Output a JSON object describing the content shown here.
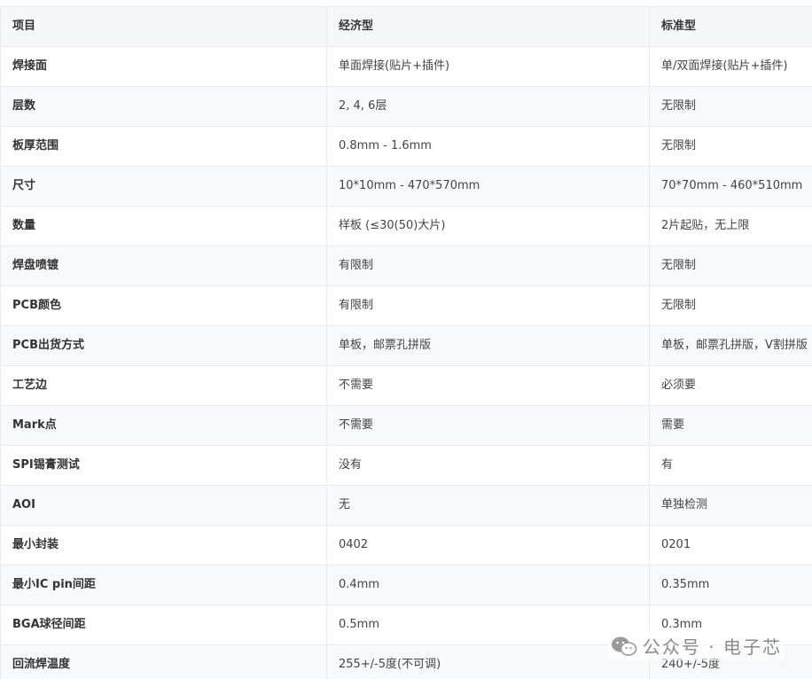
{
  "table": {
    "headers": [
      "项目",
      "经济型",
      "标准型"
    ],
    "rows": [
      [
        "焊接面",
        "单面焊接(贴片+插件)",
        "单/双面焊接(贴片+插件)"
      ],
      [
        "层数",
        "2, 4, 6层",
        "无限制"
      ],
      [
        "板厚范围",
        "0.8mm - 1.6mm",
        "无限制"
      ],
      [
        "尺寸",
        "10*10mm - 470*570mm",
        "70*70mm - 460*510mm"
      ],
      [
        "数量",
        "样板 (≤30(50)大片)",
        "2片起贴，无上限"
      ],
      [
        "焊盘喷镀",
        "有限制",
        "无限制"
      ],
      [
        "PCB颜色",
        "有限制",
        "无限制"
      ],
      [
        "PCB出货方式",
        "单板，邮票孔拼版",
        "单板，邮票孔拼版，V割拼版"
      ],
      [
        "工艺边",
        "不需要",
        "必须要"
      ],
      [
        "Mark点",
        "不需要",
        "需要"
      ],
      [
        "SPI锡膏测试",
        "没有",
        "有"
      ],
      [
        "AOI",
        "无",
        "单独检测"
      ],
      [
        "最小封装",
        "0402",
        "0201"
      ],
      [
        "最小IC pin间距",
        "0.4mm",
        "0.35mm"
      ],
      [
        "BGA球径间距",
        "0.5mm",
        "0.3mm"
      ],
      [
        "回流焊温度",
        "255+/-5度(不可调)",
        "240+/-5度"
      ]
    ]
  },
  "watermark": {
    "text": "公众号 · 电子芯",
    "icon": "wechat-icon"
  },
  "colors": {
    "header_bg": "#f5f7fa",
    "stripe_bg": "#f8f9fb",
    "border": "#e8ebef",
    "text": "#333333",
    "watermark": "#8a8a8a"
  }
}
